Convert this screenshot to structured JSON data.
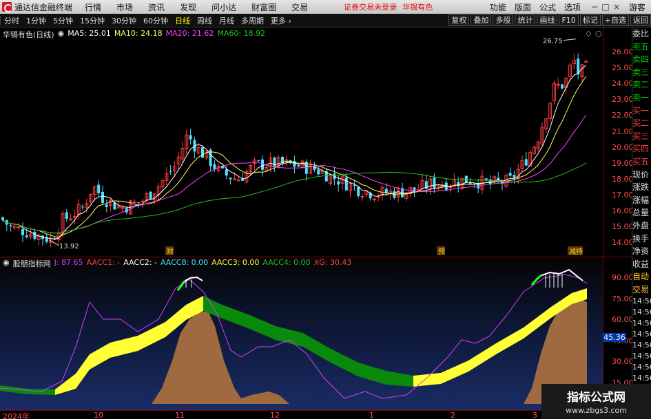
{
  "app": {
    "title": "通达信金融终端",
    "menu": [
      "行情",
      "市场",
      "资讯",
      "发现",
      "问小达",
      "财富圈",
      "交易"
    ],
    "login_status": "证券交易未登录",
    "stock_name": "华锡有色",
    "right_menu": [
      "功能",
      "版面",
      "公式",
      "选项"
    ],
    "user": "游客"
  },
  "periods": {
    "items": [
      "分时",
      "1分钟",
      "5分钟",
      "15分钟",
      "30分钟",
      "60分钟",
      "日线",
      "周线",
      "月线",
      "多周期"
    ],
    "active": "日线",
    "more": "更多"
  },
  "tools": [
    "复权",
    "叠加",
    "多股",
    "统计",
    "画线",
    "F10",
    "标记",
    "+自选",
    "返回"
  ],
  "main_header": {
    "title": "华锡有色(日线)",
    "ma5": "MA5: 25.01",
    "ma10": "MA10: 24.18",
    "ma20": "MA20: 21.62",
    "ma60": "MA60: 18.92"
  },
  "indicator_header": {
    "name": "股朋指标网",
    "j": "J: 87.65",
    "aacc1": "AACC1: -",
    "aacc2": "AACC2: -",
    "aacc8": "AACC8: 0.00",
    "aacc3": "AACC3: 0.00",
    "aacc4": "AACC4: 0.00",
    "xg": "XG: 30.43"
  },
  "price_axis": [
    "26.00",
    "25.00",
    "24.00",
    "23.00",
    "22.00",
    "21.00",
    "20.00",
    "19.00",
    "18.00",
    "17.00",
    "16.00",
    "15.00",
    "14.00"
  ],
  "indicator_axis": [
    "90.00",
    "75.00",
    "60.00",
    "45.00",
    "30.00",
    "15.00"
  ],
  "current_indicator_value": "45.36",
  "price_annotations": {
    "high": "26.75",
    "low": "13.92"
  },
  "event_markers": [
    "财",
    "预",
    "减持"
  ],
  "date_axis": [
    "2024年",
    "10",
    "11",
    "12",
    "1",
    "2",
    "3"
  ],
  "right_panel": {
    "items": [
      "委比",
      "卖五",
      "卖四",
      "卖三",
      "卖二",
      "卖一",
      "买一",
      "买二",
      "买三",
      "买四",
      "买五",
      "现价",
      "涨跌",
      "涨幅",
      "总量",
      "外盘",
      "换手",
      "净资",
      "收益"
    ],
    "tabs": [
      "自动",
      "交易"
    ],
    "times": [
      "14:56",
      "14:56",
      "14:56",
      "14:56",
      "14:56",
      "14:56",
      "14:56",
      "14:56",
      "14:56",
      "14:56"
    ]
  },
  "colors": {
    "up": "#ff3c3c",
    "down": "#4fe0ff",
    "ma5": "#ffffff",
    "ma10": "#ffff66",
    "ma20": "#ff40ff",
    "ma60": "#22c022",
    "band_yellow": "#ffff33",
    "band_green": "#0a8a0a",
    "area_brown": "#a06a40",
    "j_line": "#d040ff"
  },
  "watermark": {
    "title": "指标公式网",
    "url": "www.zbgs3.com"
  }
}
